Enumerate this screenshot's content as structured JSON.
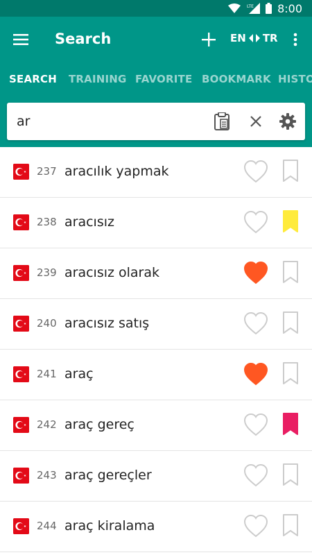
{
  "status": {
    "time": "8:00",
    "network": "LTE"
  },
  "app_bar": {
    "title": "Search",
    "lang_from": "EN",
    "lang_to": "TR"
  },
  "tabs": [
    {
      "label": "SEARCH",
      "active": true
    },
    {
      "label": "TRAINING",
      "active": false
    },
    {
      "label": "FAVORITE",
      "active": false
    },
    {
      "label": "BOOKMARK",
      "active": false
    },
    {
      "label": "HISTOR",
      "active": false
    }
  ],
  "search": {
    "value": "ar"
  },
  "colors": {
    "primary": "#009688",
    "primary_dark": "#00796b",
    "heart_active": "#ff5722",
    "bookmark_yellow": "#ffeb3b",
    "bookmark_pink": "#e91e63",
    "flag_red": "#e30a17"
  },
  "results": [
    {
      "num": "237",
      "word": "aracılık yapmak",
      "favorite": false,
      "bookmark": "none"
    },
    {
      "num": "238",
      "word": "aracısız",
      "favorite": false,
      "bookmark": "yellow"
    },
    {
      "num": "239",
      "word": "aracısız olarak",
      "favorite": true,
      "bookmark": "none"
    },
    {
      "num": "240",
      "word": "aracısız satış",
      "favorite": false,
      "bookmark": "none"
    },
    {
      "num": "241",
      "word": "araç",
      "favorite": true,
      "bookmark": "none"
    },
    {
      "num": "242",
      "word": "araç gereç",
      "favorite": false,
      "bookmark": "pink"
    },
    {
      "num": "243",
      "word": "araç gereçler",
      "favorite": false,
      "bookmark": "none"
    },
    {
      "num": "244",
      "word": "araç kiralama",
      "favorite": false,
      "bookmark": "none"
    }
  ]
}
